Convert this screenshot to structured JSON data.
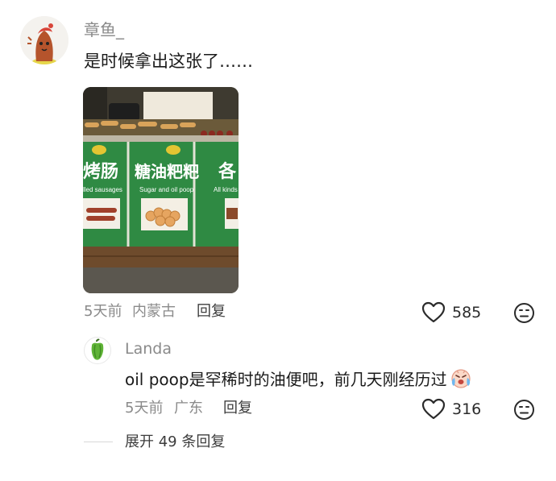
{
  "main_comment": {
    "username": "章鱼_",
    "text": "是时候拿出这张了……",
    "photo": {
      "signs": [
        "烤肠",
        "糖油粑粑",
        "各"
      ],
      "captions": [
        "lled sausages",
        "Sugar and oil poop",
        "All kinds"
      ]
    },
    "time": "5天前",
    "location": "内蒙古",
    "reply_label": "回复",
    "likes": "585"
  },
  "reply": {
    "username": "Landa",
    "text": "oil poop是罕稀时的油便吧，前几天刚经历过",
    "time": "5天前",
    "location": "广东",
    "reply_label": "回复",
    "likes": "316"
  },
  "expand_label": "展开 49 条回复",
  "icons": {
    "like": "heart-outline-icon",
    "dislike": "frown-face-icon",
    "crying": "crying-face-emoji-icon"
  },
  "colors": {
    "sign_green": "#2f8a43",
    "meta_gray": "#8a8a8a",
    "text_dark": "#1a1a1a"
  }
}
